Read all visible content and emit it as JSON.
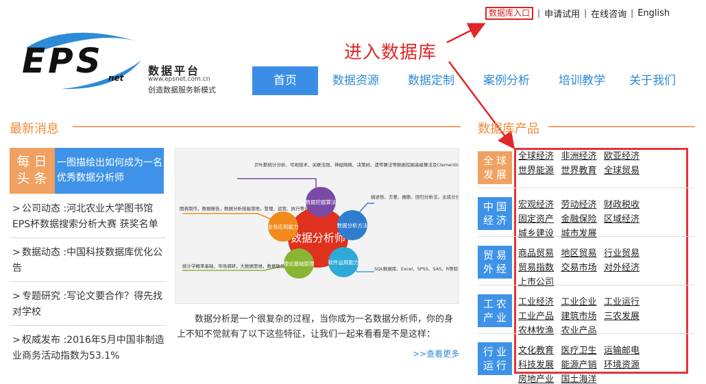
{
  "top_links": {
    "database_entry": "数据库入口",
    "apply_trial": "申请试用",
    "online_consult": "在线咨询",
    "english": "English",
    "separator": "|"
  },
  "logo": {
    "brand": "EPS",
    "brand_sub": "net",
    "name": "数据平台",
    "url": "www.epsnet.com.cn",
    "slogan": "创造数据服务新模式"
  },
  "annotation": {
    "text": "进入数据库",
    "color": "#e02626"
  },
  "nav": {
    "items": [
      "首页",
      "数据资源",
      "数据定制",
      "案例分析",
      "培训教学",
      "关于我们"
    ],
    "active_index": 0
  },
  "latest_news": {
    "title": "最新消息",
    "daily": {
      "tag_line1": "每日",
      "tag_line2": "头条",
      "headline": "一图描绘出如何成为一名优秀数据分析师"
    },
    "items": [
      {
        "bullet": ">",
        "text": "公司动态 :河北农业大学图书馆EPS杯数据搜索分析大赛 获奖名单"
      },
      {
        "bullet": ">",
        "text": "数据动态 :中国科技数据库优化公告"
      },
      {
        "bullet": ">",
        "text": "专题研究 :写论文要合作？得先找对学校"
      },
      {
        "bullet": ">",
        "text": "权威发布 :2016年5月中国非制造业商务活动指数为53.1%"
      }
    ]
  },
  "diagram": {
    "center": "数据分析师",
    "nodes": [
      {
        "label": "数据挖掘算法",
        "color": "#7b4aa6"
      },
      {
        "label": "数据分析方法",
        "color": "#2f7dcf"
      },
      {
        "label": "软件运用能力",
        "color": "#2ea9d8"
      },
      {
        "label": "理论基础原理",
        "color": "#8ab534"
      },
      {
        "label": "业务应用能力",
        "color": "#f28a1c"
      }
    ],
    "notes": [
      "贝叶斯统计分析、可视技术、关联法则、神经网络、决策树、遗传算法等数据挖掘高级算法及Clementine、R语言等工具技法",
      "描述性、方差、推断、回归分析法，主成分分析法，典型相关分析，因子分析法，判别分析法，聚类分析法，Logistic模型等数据分析方法",
      "SQL数据库、Excel、SPSS、SAS、R等软件操作及应用能力",
      "统计学概率基础，市场调研，大数据思维，数据敏感度",
      "图表制作，数据报告，数据分析技能落地，管理、运营、执行等业务应用"
    ],
    "center_color": "#e0301e"
  },
  "article": {
    "desc": "数据分析是一个很复杂的过程，当你成为一名数据分析师，你的身上不知不觉就有了以下这些特征，让我们一起来看看是不是这样：",
    "more": ">>查看更多"
  },
  "products": {
    "title": "数据库产品",
    "categories": [
      {
        "line1": "全球",
        "line2": "发展",
        "style": "orange",
        "items": [
          "全球经济",
          "非洲经济",
          "欧亚经济",
          "世界能源",
          "世界教育",
          "全球贸易"
        ]
      },
      {
        "line1": "中国",
        "line2": "经济",
        "style": "blue",
        "items": [
          "宏观经济",
          "劳动经济",
          "财政税收",
          "固定资产",
          "金融保险",
          "区域经济",
          "城乡建设",
          "城市发展"
        ]
      },
      {
        "line1": "贸易",
        "line2": "外经",
        "style": "blue",
        "items": [
          "商品贸易",
          "地区贸易",
          "行业贸易",
          "贸易指数",
          "交易市场",
          "对外经济",
          "上市公司"
        ]
      },
      {
        "line1": "工农",
        "line2": "产业",
        "style": "blue",
        "items": [
          "工业经济",
          "工业企业",
          "工业运行",
          "工业产品",
          "建筑市场",
          "三农发展",
          "农林牧渔",
          "农业产品"
        ]
      },
      {
        "line1": "行业",
        "line2": "运行",
        "style": "blue",
        "items": [
          "文化教育",
          "医疗卫生",
          "运输邮电",
          "科技发展",
          "能源产销",
          "环境资源",
          "房地产业",
          "国土海洋"
        ]
      }
    ]
  },
  "colors": {
    "accent_blue": "#3e93e8",
    "accent_orange": "#f0a060",
    "highlight_red": "#e53434"
  }
}
